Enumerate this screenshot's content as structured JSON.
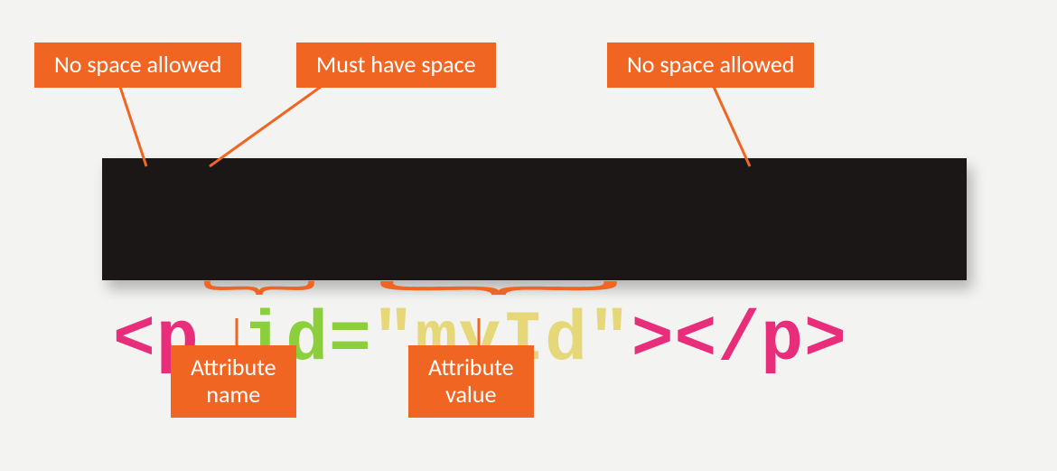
{
  "callouts": {
    "no_space_left": "No space allowed",
    "must_have_space": "Must have space",
    "no_space_right": "No space allowed",
    "attr_name": "Attribute\nname",
    "attr_value": "Attribute\nvalue"
  },
  "code": {
    "lt": "<",
    "tag_open": "p",
    "space": " ",
    "attr": "id=",
    "value": "\"myId\"",
    "gt": ">",
    "close": "</p>"
  },
  "colors": {
    "callout_bg": "#f06522",
    "code_bg": "#1a1716",
    "pink": "#e82e7b",
    "green": "#8ccf3c",
    "yellow": "#e6d779"
  }
}
